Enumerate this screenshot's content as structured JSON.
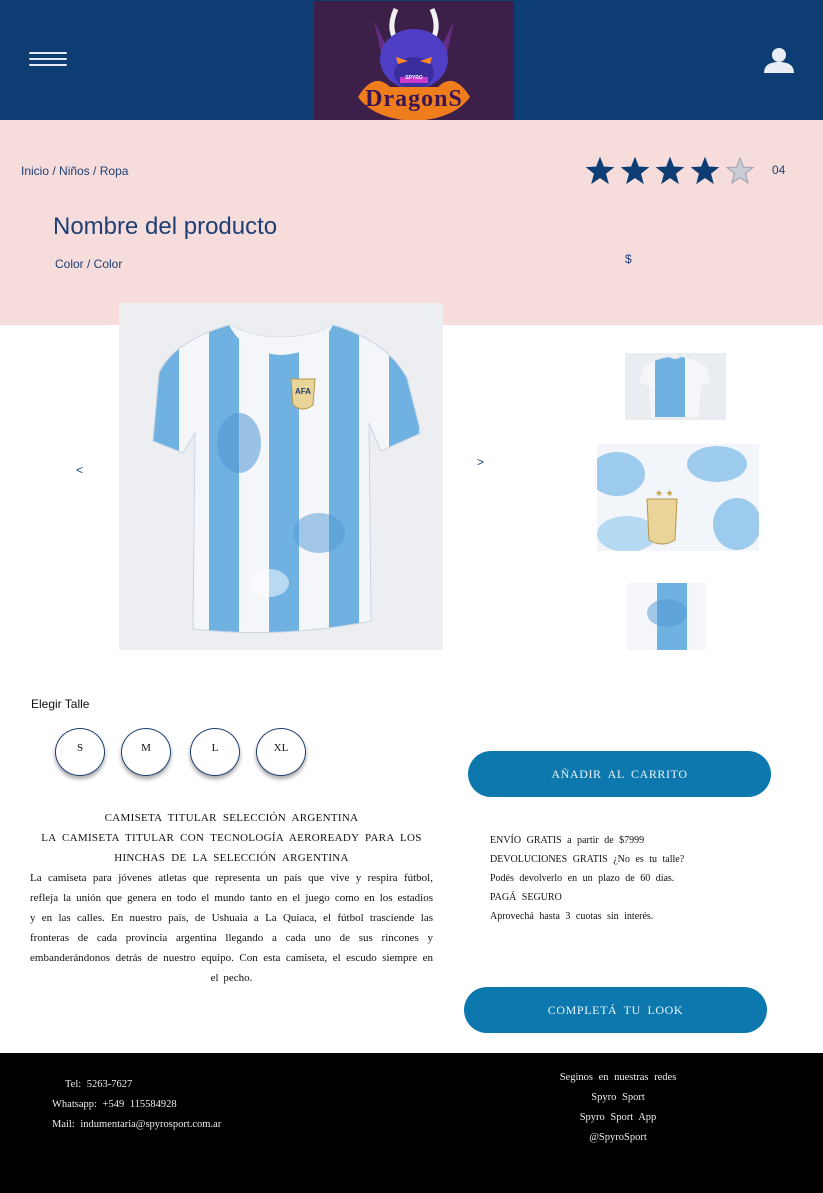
{
  "header": {
    "logo_text": "DragonS",
    "logo_small_text": "SPYRO"
  },
  "breadcrumb": {
    "items": [
      "Inicio",
      "Niños",
      "Ropa"
    ],
    "separator": " / "
  },
  "rating": {
    "stars_filled": 4,
    "stars_total": 5,
    "count": "04"
  },
  "product": {
    "name": "Nombre del producto",
    "color": "Color / Color",
    "price": "$"
  },
  "gallery": {
    "prev": "<",
    "next": ">",
    "crest_text": "AFA"
  },
  "sizes": {
    "label": "Elegir Talle",
    "options": [
      "S",
      "M",
      "L",
      "XL"
    ]
  },
  "actions": {
    "add_to_cart": "AÑADIR AL CARRITO",
    "complete_look": "COMPLETÁ TU LOOK"
  },
  "description": {
    "title": "CAMISETA TITULAR SELECCIÓN ARGENTINA",
    "subtitle": "LA CAMISETA TITULAR CON TECNOLOGÍA AEROREADY PARA LOS HINCHAS DE LA SELECCIÓN ARGENTINA",
    "body": "La camiseta para jóvenes atletas que representa un país que vive y respira fútbol, refleja la unión que genera en todo el mundo tanto en el juego como en los estadios y en las calles. En nuestro país, de Ushuaia a La Quiaca, el fútbol trasciende las fronteras de cada provincia argentina llegando a cada uno de sus rincones y embanderándonos detrás de nuestro equipo. Con esta camiseta, el escudo siempre en el pecho."
  },
  "shipping": {
    "lines": [
      "ENVÍO GRATIS a partir de $7999",
      "DEVOLUCIONES GRATIS ¿No es tu talle?",
      "Podés devolverlo en un plazo de 60 días.",
      "PAGÁ SEGURO",
      "Aprovechá hasta 3 cuotas sin interés."
    ]
  },
  "footer": {
    "contact": {
      "tel": "Tel: 5263-7627",
      "whatsapp": "Whatsapp: +549 115584928",
      "mail": "Mail: indumentaria@spyrosport.com.ar"
    },
    "social": {
      "heading": "Seginos en nuestras redes",
      "links": [
        "Spyro Sport",
        "Spyro Sport App",
        "@SpyroSport"
      ]
    }
  },
  "colors": {
    "header_bg": "#0e3d73",
    "band_bg": "#f6dddc",
    "accent_button": "#0d78ad",
    "text_primary": "#1d3f73",
    "footer_bg": "#000000",
    "shirt_blue": "#5aa6dc"
  }
}
